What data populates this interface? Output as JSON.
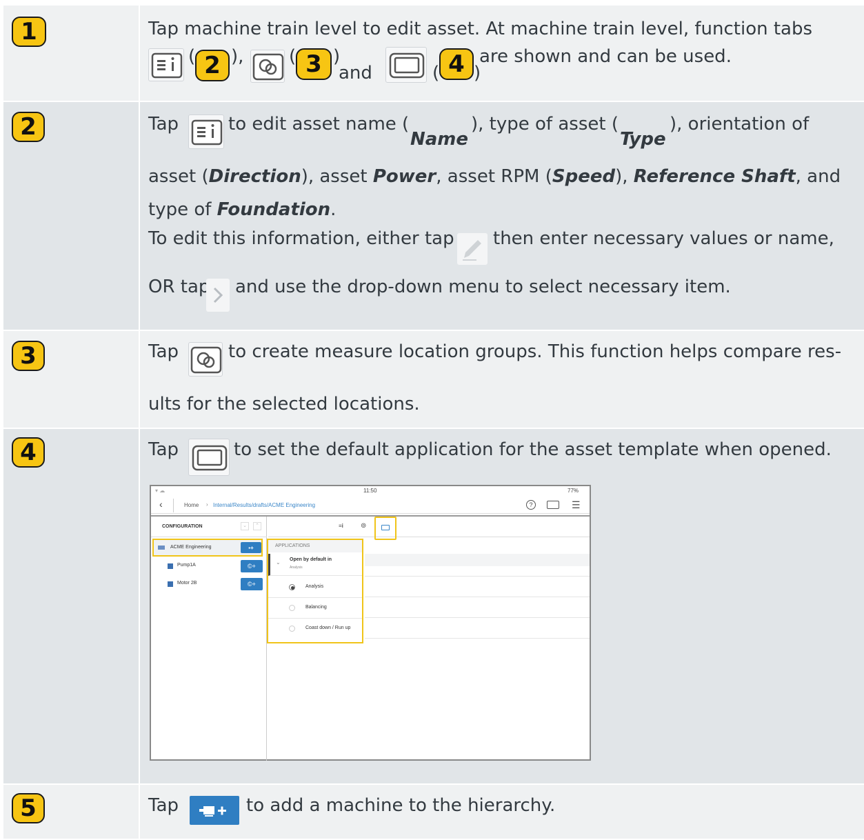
{
  "rows": [
    {
      "num": "1",
      "line1": "Tap machine train level to edit asset. At machine train level, function tabs",
      "paren_open": "(",
      "paren_close_comma": "),",
      "paren_close": ")",
      "badge2": "2",
      "badge3": "3",
      "badge4": "4",
      "and": "and",
      "tail": "are shown and can be used."
    },
    {
      "num": "2",
      "tap": "Tap",
      "t1": "to edit asset name (",
      "name": "Name",
      "t2": "), type of asset (",
      "type": "Type",
      "t3": "), orientation of",
      "l2a": "asset (",
      "direction": "Direction",
      "l2b": "), asset ",
      "power": "Power",
      "l2c": ", asset RPM (",
      "speed": "Speed",
      "l2d": "), ",
      "refshaft": "Reference Shaft",
      "l2e": ", and",
      "l3a": "type of ",
      "foundation": "Foundation",
      "l3b": ".",
      "l4a": "To edit this information, either tap",
      "l4b": "then enter necessary values or name,",
      "l5a": "OR tap",
      "l5b": "and use the drop-down menu to select necessary item."
    },
    {
      "num": "3",
      "tap": "Tap",
      "t1": "to create measure location groups. This function helps compare res-",
      "t2": "ults for the selected locations."
    },
    {
      "num": "4",
      "tap": "Tap",
      "t1": "to set the default application for the asset template when opened."
    },
    {
      "num": "5",
      "tap": "Tap",
      "t1": "to add a machine to the hierarchy."
    }
  ],
  "screenshot": {
    "time": "11:50",
    "battery": "77%",
    "breadcrumb_home": "Home",
    "breadcrumb_sep": "›",
    "breadcrumb_path": "Internal/Results/drafts/ACME Engineering",
    "config_label": "CONFIGURATION",
    "tree": [
      "ACME Engineering",
      "Pump1A",
      "Motor 2B"
    ],
    "applications_label": "APPLICATIONS",
    "open_default": "Open by default in",
    "open_default_sub": "Analysis",
    "options": [
      "Analysis",
      "Balancing",
      "Coast down / Run up"
    ],
    "selected_option": "Analysis"
  },
  "colors": {
    "badge": "#f7c513",
    "row_light": "#eff1f2",
    "row_dark": "#e1e5e8",
    "accent_blue": "#2f7ec2",
    "highlight": "#f0c419"
  }
}
